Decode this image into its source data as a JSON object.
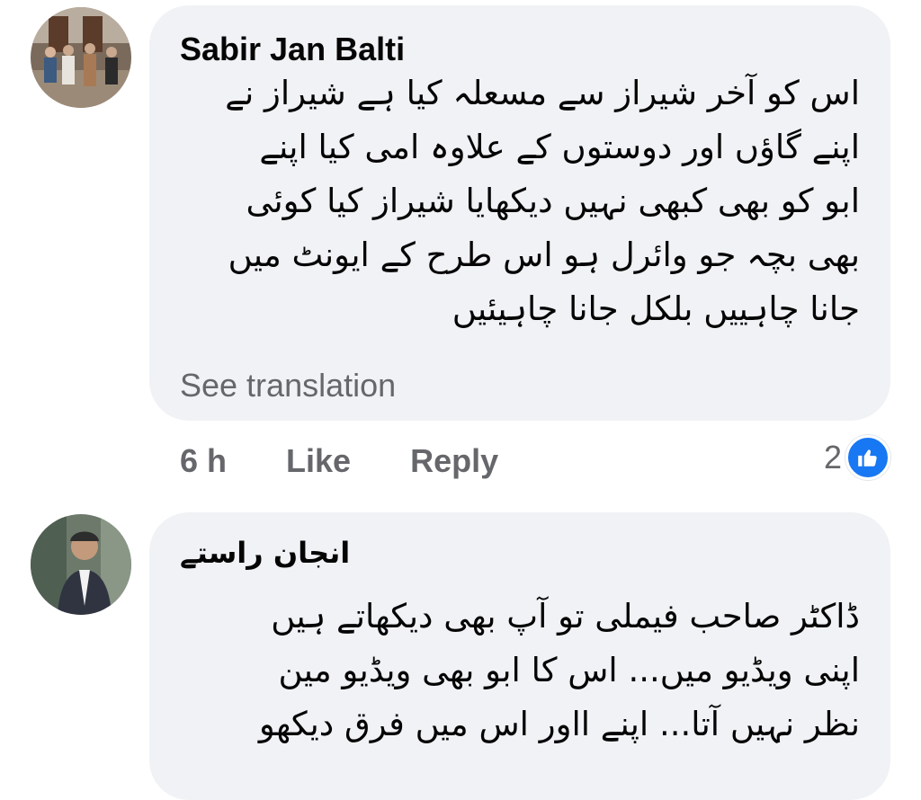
{
  "comments": [
    {
      "author": "Sabir Jan Balti",
      "lines": [
        "اس کو آخر شیراز سے مسعلہ کیا ہے شیراز نے",
        "اپنے گاؤں اور دوستوں کے علاوہ امی کیا اپنے",
        "ابو کو بھی کبھی نہیں دیکھایا شیراز کیا کوئی",
        "بھی بچہ جو وائرل ہو اس طرح کے ایونٹ میں",
        "جانا چاہییں بلکل جانا چاہیئیں"
      ],
      "see_translation": "See translation",
      "time": "6 h",
      "like_label": "Like",
      "reply_label": "Reply",
      "reaction_count": "2",
      "reaction_icon": "thumbs-up-icon"
    },
    {
      "author": "انجان راستے",
      "lines": [
        "ڈاکٹر صاحب فیملی تو آپ بھی دیکھاتے ہیں",
        "اپنی ویڈیو میں... اس کا ابو بھی ویڈیو مین",
        "نظر نہیں آتا... اپنے ااور اس میں فرق دیکھو"
      ]
    }
  ],
  "colors": {
    "bubble": "#f0f2f5",
    "text": "#050505",
    "secondary": "#65676b",
    "like_blue": "#1877f2"
  }
}
